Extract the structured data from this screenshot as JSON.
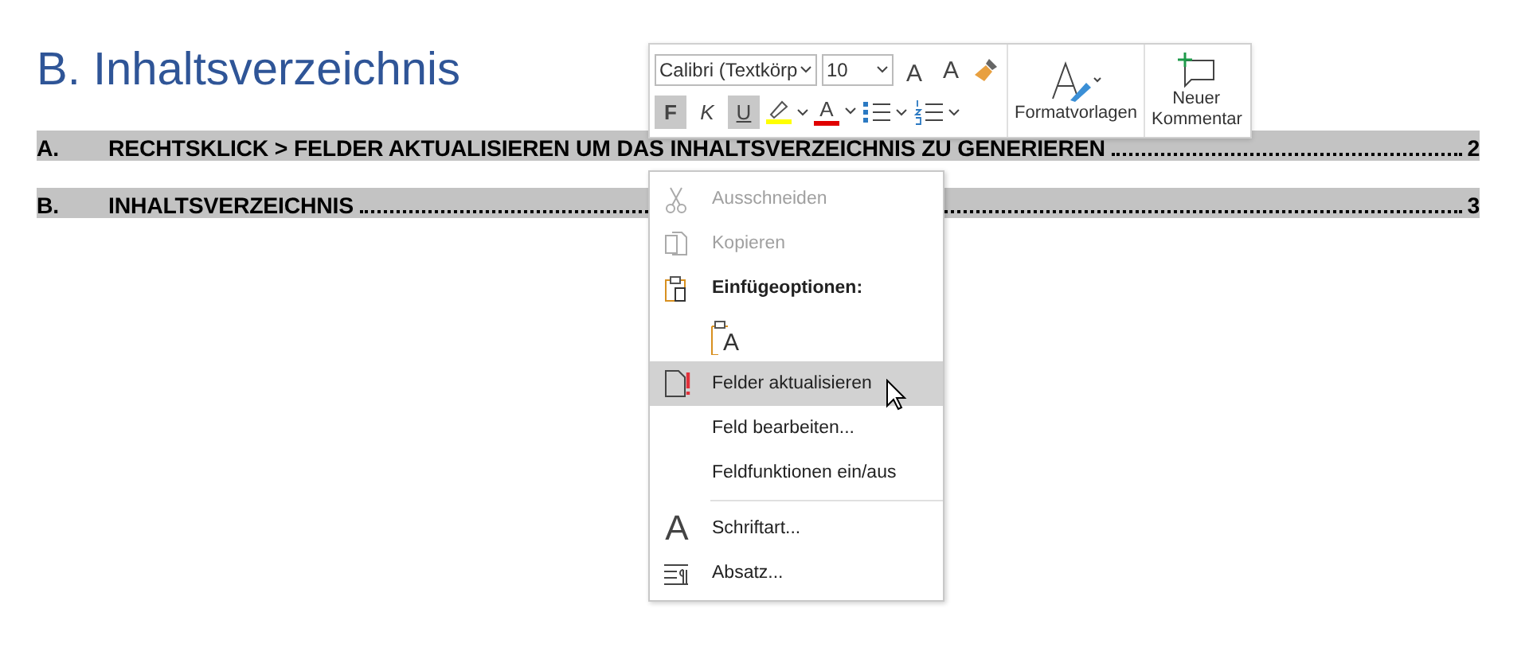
{
  "heading": "B. Inhaltsverzeichnis",
  "toc": [
    {
      "number": "A.",
      "title": "RECHTSKLICK > FELDER AKTUALISIEREN UM DAS INHALTSVERZEICHNIS ZU GENERIEREN",
      "page": "2",
      "selected": true
    },
    {
      "number": "B.",
      "title": "INHALTSVERZEICHNIS",
      "page": "3",
      "selected": true
    }
  ],
  "toolbar": {
    "font": "Calibri (Textkörp",
    "size": "10",
    "grow_font": "A",
    "shrink_font": "A",
    "format_buttons": [
      {
        "label": "F",
        "kind": "bold",
        "on": true
      },
      {
        "label": "K",
        "kind": "italic",
        "on": false
      },
      {
        "label": "U",
        "kind": "underline",
        "on": true
      }
    ],
    "font_color_glyph": "A",
    "styles": "Formatvorlagen",
    "comment": "Neuer Kommentar"
  },
  "context_menu": [
    {
      "kind": "item",
      "label": "Ausschneiden",
      "disabled": true,
      "selected": false
    },
    {
      "kind": "item",
      "label": "Kopieren",
      "disabled": true,
      "selected": false
    },
    {
      "kind": "header",
      "label": "Einfügeoptionen:"
    },
    {
      "kind": "paste",
      "glyph": "A"
    },
    {
      "kind": "item",
      "label": "Felder aktualisieren",
      "disabled": false,
      "selected": true
    },
    {
      "kind": "item",
      "label": "Feld bearbeiten...",
      "disabled": false,
      "selected": false
    },
    {
      "kind": "item",
      "label": "Feldfunktionen ein/aus",
      "disabled": false,
      "selected": false
    },
    {
      "kind": "separator"
    },
    {
      "kind": "item",
      "label": "Schriftart...",
      "glyph": "A",
      "disabled": false,
      "selected": false
    },
    {
      "kind": "item",
      "label": "Absatz...",
      "disabled": false,
      "selected": false
    }
  ]
}
